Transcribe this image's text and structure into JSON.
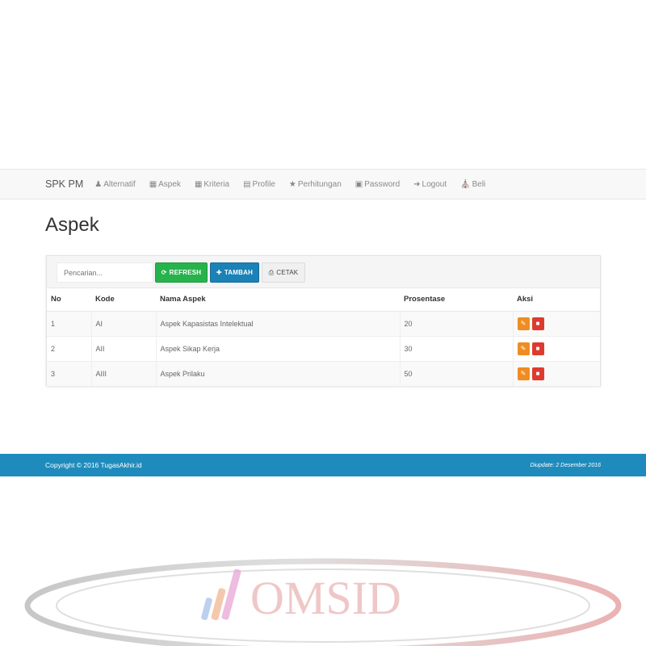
{
  "navbar": {
    "brand": "SPK PM",
    "items": [
      {
        "label": "Alternatif",
        "icon": "user-icon"
      },
      {
        "label": "Aspek",
        "icon": "th-large-icon"
      },
      {
        "label": "Kriteria",
        "icon": "th-icon"
      },
      {
        "label": "Profile",
        "icon": "calendar-icon"
      },
      {
        "label": "Perhitungan",
        "icon": "star-icon"
      },
      {
        "label": "Password",
        "icon": "lock-icon"
      },
      {
        "label": "Logout",
        "icon": "log-in-icon"
      },
      {
        "label": "Beli",
        "icon": "shopping-cart-icon"
      }
    ]
  },
  "page": {
    "title": "Aspek"
  },
  "toolbar": {
    "search_placeholder": "Pencarian...",
    "refresh_label": "REFRESH",
    "tambah_label": "TAMBAH",
    "cetak_label": "CETAK"
  },
  "table": {
    "headers": [
      "No",
      "Kode",
      "Nama Aspek",
      "Prosentase",
      "Aksi"
    ],
    "rows": [
      {
        "no": "1",
        "kode": "AI",
        "nama": "Aspek Kapasistas Intelektual",
        "prosentase": "20"
      },
      {
        "no": "2",
        "kode": "AII",
        "nama": "Aspek Sikap Kerja",
        "prosentase": "30"
      },
      {
        "no": "3",
        "kode": "AIII",
        "nama": "Aspek Prilaku",
        "prosentase": "50"
      }
    ]
  },
  "footer": {
    "copyright": "Copyright © 2016 TugasAkhir.id",
    "updated": "Diupdate: 2 Desember 2016"
  },
  "watermark": {
    "text": "OMSID"
  },
  "colors": {
    "refresh": "#27b34c",
    "tambah": "#1a82b6",
    "edit": "#ef8d22",
    "delete": "#dd3b30",
    "footer": "#1f8bbd"
  }
}
